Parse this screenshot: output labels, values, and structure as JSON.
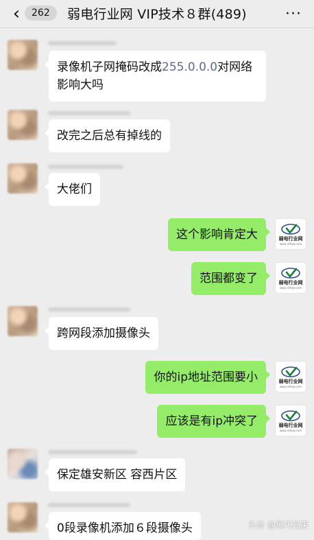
{
  "header": {
    "back_icon": "chevron-left-icon",
    "unread_count": "262",
    "title": "弱电行业网 VIP技术８群(489)",
    "more_icon": "more-dots-icon"
  },
  "logo": {
    "name": "弱电行业网",
    "url": "www.rdhyw.com"
  },
  "messages": [
    {
      "side": "left",
      "text_pre": "录像机子网掩码改成",
      "text_hl": "255.0.0.0",
      "text_post": "对网络影响大吗"
    },
    {
      "side": "left",
      "text": "改完之后总有掉线的"
    },
    {
      "side": "left",
      "text": "大佬们"
    },
    {
      "side": "right",
      "text": "这个影响肯定大"
    },
    {
      "side": "right",
      "text": "范围都变了"
    },
    {
      "side": "left",
      "text": "跨网段添加摄像头"
    },
    {
      "side": "right",
      "text": "你的ip地址范围要小"
    },
    {
      "side": "right",
      "text": "应该是有ip冲突了"
    },
    {
      "side": "left",
      "text": "保定雄安新区 容西片区"
    },
    {
      "side": "left",
      "text": "0段录像机添加６段摄像头"
    }
  ],
  "watermark": "头条 @奥巧光束",
  "colors": {
    "background": "#ededed",
    "bubble_self": "#95ec69",
    "bubble_other": "#ffffff",
    "link": "#576b95"
  }
}
